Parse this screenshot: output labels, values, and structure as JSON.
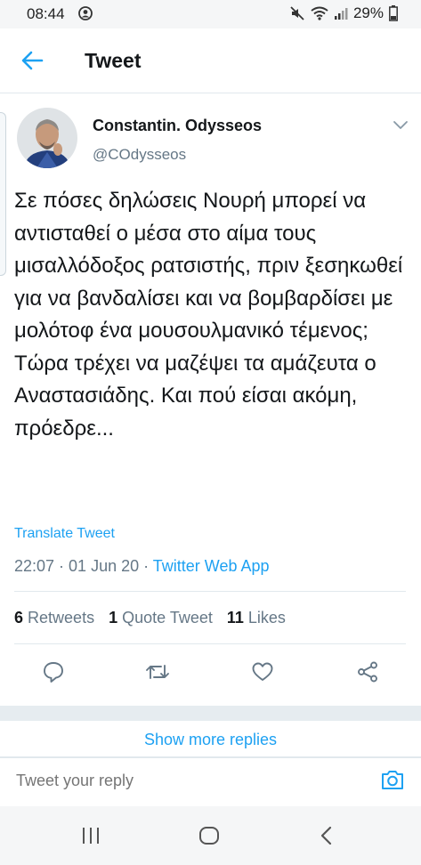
{
  "status_bar": {
    "time": "08:44",
    "battery": "29%",
    "icons": [
      "alarm-icon",
      "mute-icon",
      "wifi-icon",
      "signal-icon",
      "battery-icon"
    ]
  },
  "header": {
    "title": "Tweet"
  },
  "tweet": {
    "author_name": "Constantin. Odysseos",
    "author_handle": "@COdysseos",
    "text": "Σε πόσες δηλώσεις Νουρή μπορεί να αντισταθεί ο μέσα στο αίμα τους μισαλλόδοξος ρατσιστής, πριν ξεσηκωθεί για να βανδαλίσει και να βομβαρδίσει με μολότοφ ένα μουσουλμανικό τέμενος; Τώρα τρέχει να μαζέψει τα αμάζευτα ο Αναστασιάδης. Και πού είσαι ακόμη, πρόεδρε...",
    "translate_label": "Translate Tweet",
    "time": "22:07",
    "date": "01 Jun 20",
    "source": "Twitter Web App",
    "sep": " · "
  },
  "stats": {
    "retweets_count": "6",
    "retweets_label": "Retweets",
    "quotes_count": "1",
    "quotes_label": "Quote Tweet",
    "likes_count": "11",
    "likes_label": "Likes"
  },
  "replies": {
    "show_more": "Show more replies",
    "reply_placeholder": "Tweet your reply"
  },
  "colors": {
    "accent": "#1da1f2",
    "text": "#14171a",
    "secondary": "#657786",
    "border": "#e1e8ed"
  }
}
